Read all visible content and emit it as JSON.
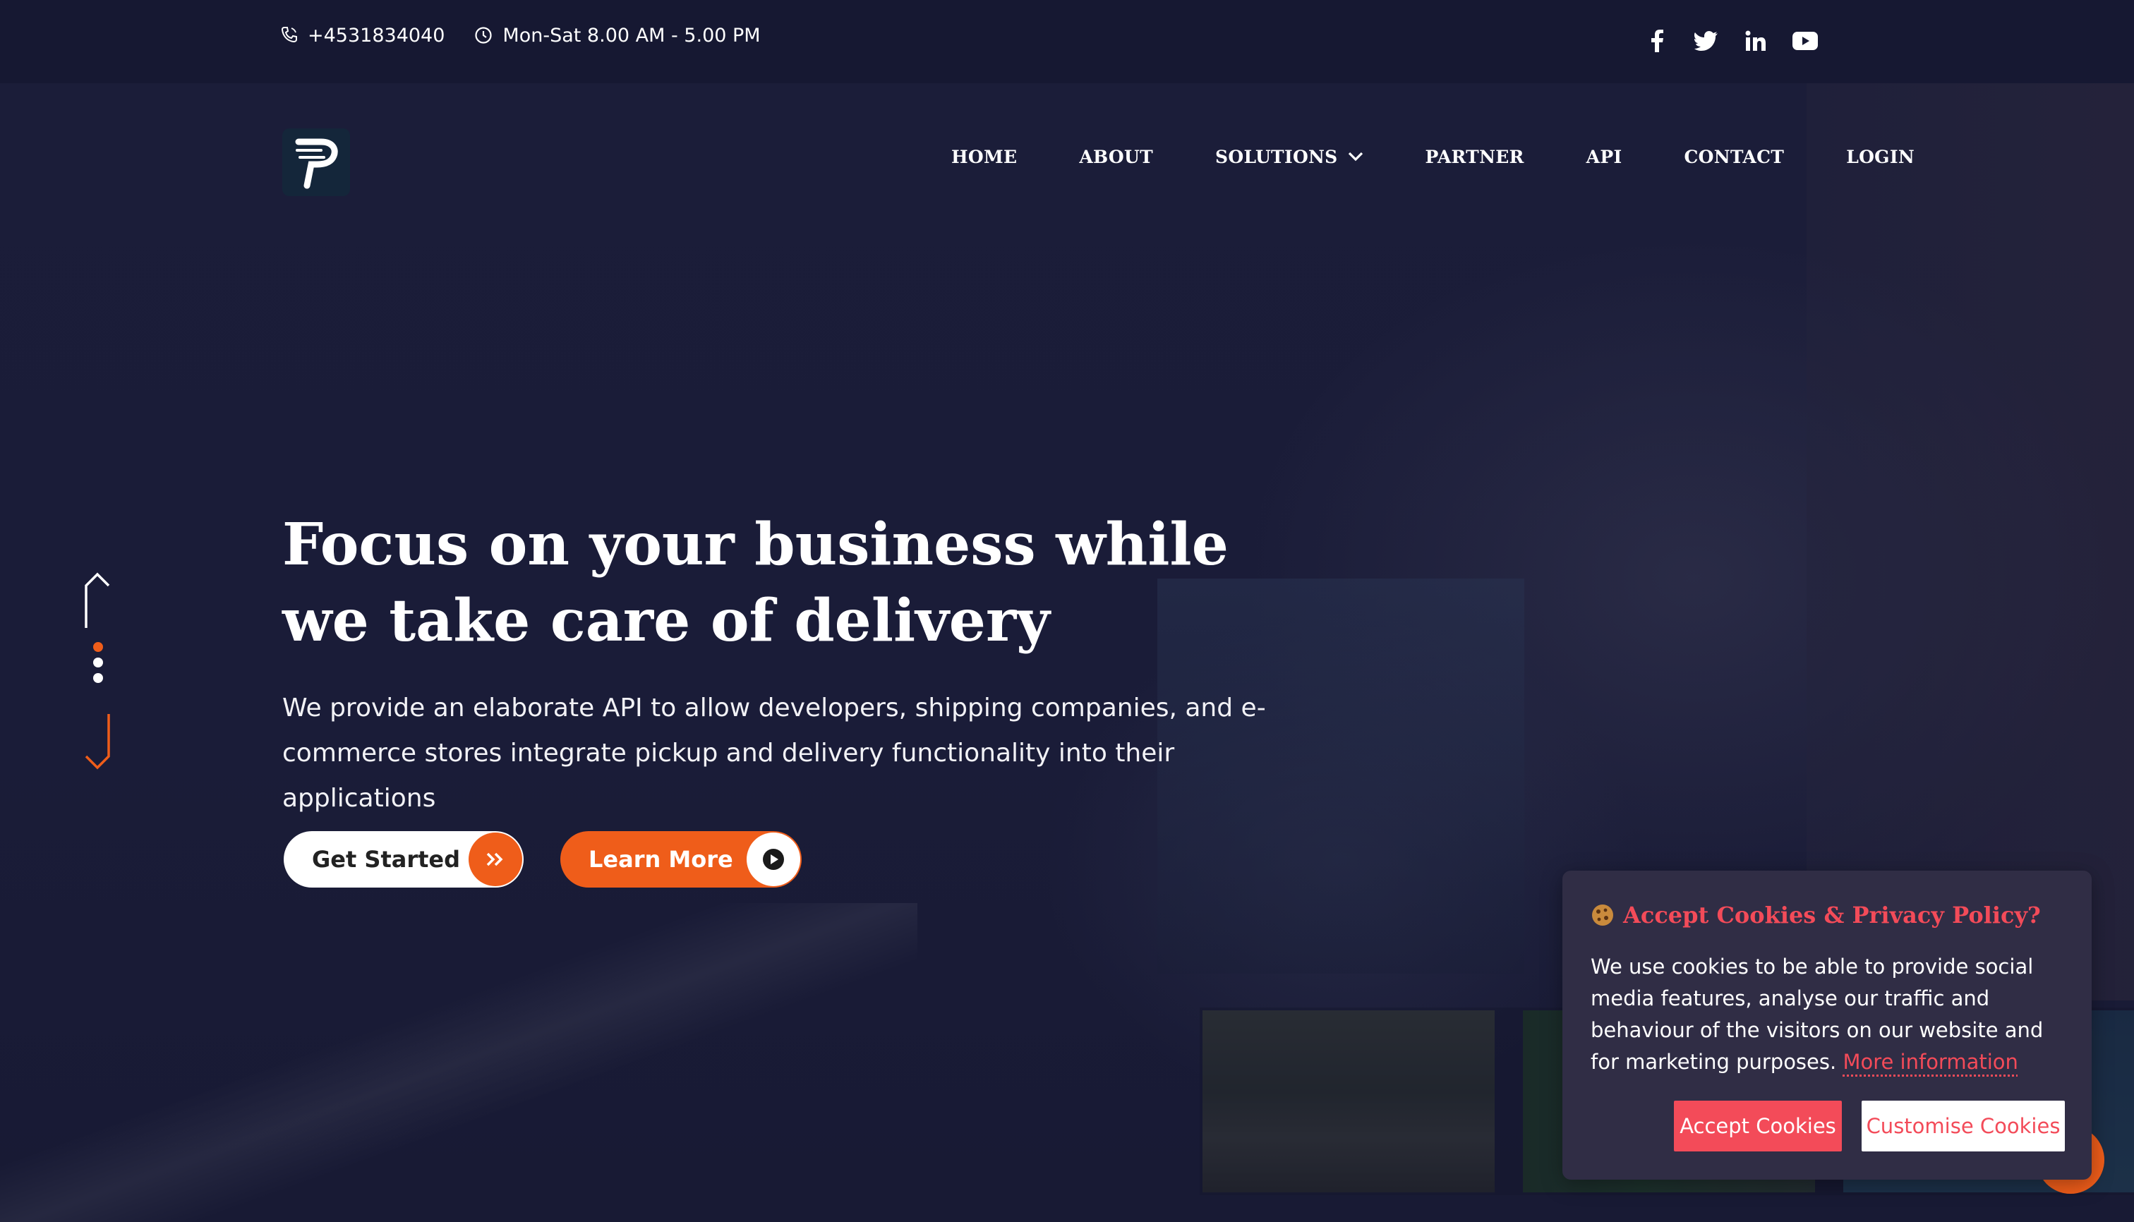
{
  "topbar": {
    "phone": "+4531834040",
    "hours": "Mon-Sat 8.00 AM - 5.00 PM",
    "social_icons": [
      "facebook-icon",
      "twitter-icon",
      "linkedin-icon",
      "youtube-icon"
    ]
  },
  "nav": {
    "items": [
      {
        "label": "HOME"
      },
      {
        "label": "ABOUT"
      },
      {
        "label": "SOLUTIONS"
      },
      {
        "label": "PARTNER"
      },
      {
        "label": "API"
      },
      {
        "label": "CONTACT"
      },
      {
        "label": "LOGIN"
      }
    ]
  },
  "hero": {
    "title": "Focus on your business while we take care of delivery",
    "subtitle": "We provide an elaborate API to allow developers, shipping companies, and e-commerce stores integrate pickup and delivery functionality into their applications",
    "primary_button": "Get Started",
    "secondary_button": "Learn More"
  },
  "cookie": {
    "title": "Accept Cookies & Privacy Policy?",
    "body": "We use cookies to be able to provide social media features, analyse our traffic and behaviour of the visitors on our website and for marketing purposes.",
    "more_link": "More information",
    "accept": "Accept Cookies",
    "customise": "Customise Cookies"
  },
  "colors": {
    "accent": "#ef5d1a",
    "cookie_accent": "#f34b59",
    "background": "#1a1c36",
    "topbar": "#161832",
    "popup": "#302d45"
  }
}
